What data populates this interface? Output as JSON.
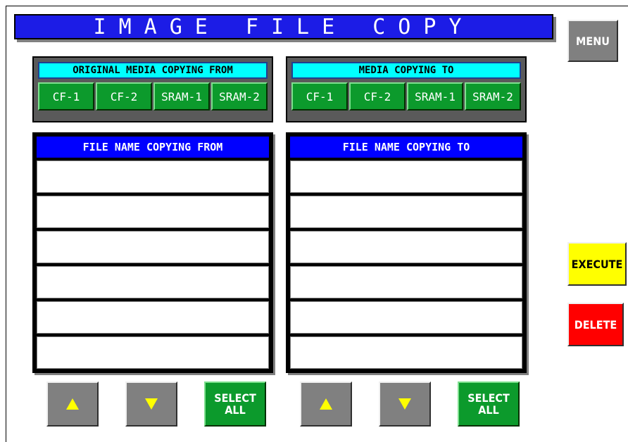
{
  "title": "IMAGE FILE COPY",
  "menu_label": "MENU",
  "execute_label": "EXECUTE",
  "delete_label": "DELETE",
  "source_media": {
    "header": "ORIGINAL MEDIA COPYING FROM",
    "options": [
      "CF-1",
      "CF-2",
      "SRAM-1",
      "SRAM-2"
    ]
  },
  "target_media": {
    "header": "MEDIA COPYING TO",
    "options": [
      "CF-1",
      "CF-2",
      "SRAM-1",
      "SRAM-2"
    ]
  },
  "source_files": {
    "header": "FILE NAME COPYING FROM",
    "rows": [
      "",
      "",
      "",
      "",
      "",
      ""
    ]
  },
  "target_files": {
    "header": "FILE NAME COPYING TO",
    "rows": [
      "",
      "",
      "",
      "",
      "",
      ""
    ]
  },
  "select_all_label": "SELECT\nALL",
  "icons": {
    "scroll_up": "up-triangle-icon",
    "scroll_down": "down-triangle-icon"
  },
  "colors": {
    "title_bar": "#1c1ce6",
    "media_header": "#00ffff",
    "media_button": "#0c9a2c",
    "file_header": "#0000ff",
    "execute": "#ffff00",
    "delete": "#ff0000",
    "arrow": "#ffff00"
  }
}
